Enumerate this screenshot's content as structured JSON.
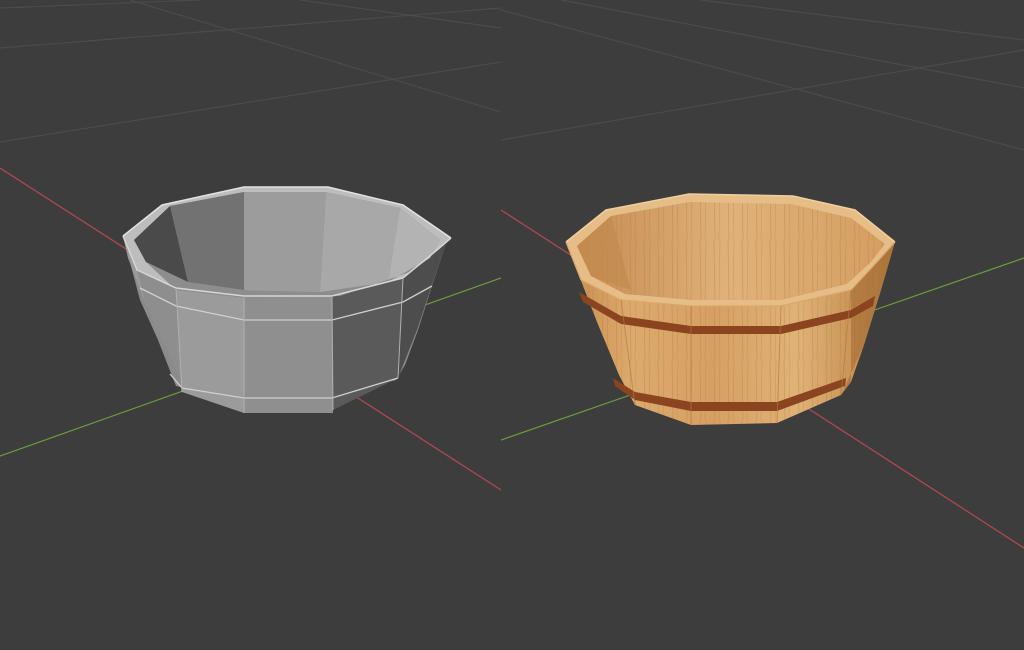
{
  "app": {
    "name": ""
  },
  "viewports": [
    {
      "id": "left",
      "shading": "solid",
      "object_icon": "tub-icon",
      "object_color": "#a9a9a9"
    },
    {
      "id": "right",
      "shading": "material-preview",
      "object_icon": "tub-icon",
      "object_color": "#d9a764",
      "band_color": "#8a4520"
    }
  ],
  "colors": {
    "background": "#3d3d3d",
    "grid": "#4a4a4a",
    "x_axis": "#b04a52",
    "y_axis": "#6a9a3a"
  }
}
